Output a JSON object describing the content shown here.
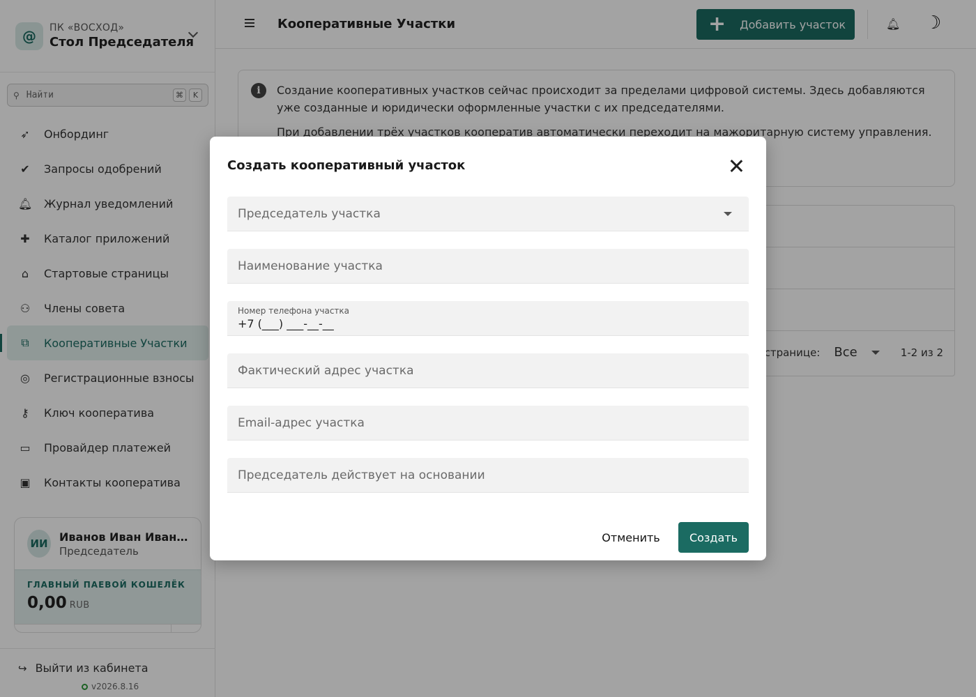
{
  "sidebar": {
    "org_short": "ПК «ВОСХОД»",
    "org_title": "Стол Председателя",
    "logo_glyph": "@",
    "search": {
      "placeholder": "Найти",
      "kbd1": "⌘",
      "kbd2": "K"
    },
    "items": [
      {
        "label": "Онбординг",
        "icon": "rocket-icon",
        "glyph": "➶"
      },
      {
        "label": "Запросы одобрений",
        "icon": "check-circle-icon",
        "glyph": "✔"
      },
      {
        "label": "Журнал уведомлений",
        "icon": "bell-icon",
        "glyph": "🔔︎"
      },
      {
        "label": "Каталог приложений",
        "icon": "puzzle-icon",
        "glyph": "✚"
      },
      {
        "label": "Стартовые страницы",
        "icon": "home-icon",
        "glyph": "⌂"
      },
      {
        "label": "Члены совета",
        "icon": "group-icon",
        "glyph": "⚇"
      },
      {
        "label": "Кооперативные Участки",
        "icon": "hierarchy-icon",
        "glyph": "⧉",
        "active": true
      },
      {
        "label": "Регистрационные взносы",
        "icon": "coins-icon",
        "glyph": "◎"
      },
      {
        "label": "Ключ кооператива",
        "icon": "key-icon",
        "glyph": "⚷"
      },
      {
        "label": "Провайдер платежей",
        "icon": "credit-card-icon",
        "glyph": "▭"
      },
      {
        "label": "Контакты кооператива",
        "icon": "contact-book-icon",
        "glyph": "▣"
      }
    ],
    "user": {
      "initials": "ИИ",
      "name": "Иванов Иван Иванов...",
      "role": "Председатель",
      "wallet_label": "ГЛАВНЫЙ ПАЕВОЙ КОШЕЛЁК",
      "wallet_amount": "0,00",
      "wallet_currency": "RUB"
    },
    "logout_label": "Выйти из кабинета",
    "version": "v2026.8.16"
  },
  "header": {
    "title": "Кооперативные Участки",
    "add_button": "Добавить участок"
  },
  "info": {
    "p1": "Создание кооперативных участков сейчас происходит за пределами цифровой системы. Здесь добавляются уже созданные и юридически оформленные участки с их председателями.",
    "p2": "При добавлении трёх участков кооператив автоматически переходит на мажоритарную систему управления. о председателю. Новые"
  },
  "table": {
    "rows_per_page_label": "на странице:",
    "rows_per_page_value": "Все",
    "pagination": "1-2 из 2"
  },
  "dialog": {
    "title": "Создать кооперативный участок",
    "fields": {
      "chairman_placeholder": "Председатель участка",
      "name_placeholder": "Наименование участка",
      "phone_label": "Номер телефона участка",
      "phone_value": "+7 (___) ___-__-__",
      "address_placeholder": "Фактический адрес участка",
      "email_placeholder": "Email-адрес участка",
      "basis_placeholder": "Председатель действует на основании"
    },
    "cancel_label": "Отменить",
    "create_label": "Создать"
  },
  "colors": {
    "accent": "#1b6b62",
    "accent_light": "#e2efed"
  }
}
